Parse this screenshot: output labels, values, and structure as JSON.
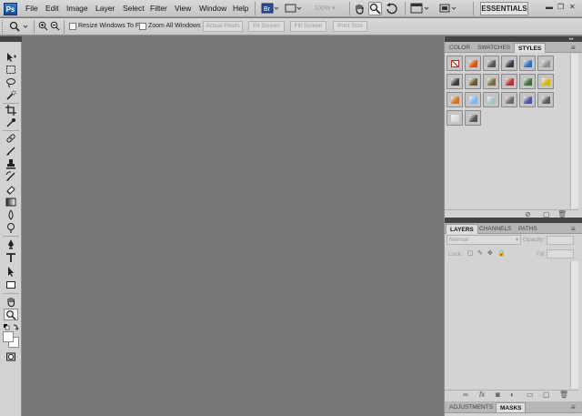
{
  "menubar": {
    "logo": "Ps",
    "items": [
      "File",
      "Edit",
      "Image",
      "Layer",
      "Select",
      "Filter",
      "View",
      "Window",
      "Help"
    ],
    "zoom_value": "100%",
    "workspace": "ESSENTIALS"
  },
  "options": {
    "resize_label": "Resize Windows To Fit",
    "zoom_all_label": "Zoom All Windows",
    "buttons": [
      "Actual Pixels",
      "Fit Screen",
      "Fill Screen",
      "Print Size"
    ]
  },
  "top_panel": {
    "tabs": [
      "COLOR",
      "SWATCHES",
      "STYLES"
    ],
    "active_tab": "STYLES",
    "style_colors": [
      "#c8c8c8",
      "#d0561a",
      "#555555",
      "#333a44",
      "#2f6fb3",
      "#8e8e8e",
      "#3c3c3c",
      "#6a5a32",
      "#7a6a3a",
      "#b0303a",
      "#3f6a3a",
      "#d6b318",
      "#c8742a",
      "#7eb6e8",
      "#a8c0c8",
      "#6a6a6a",
      "#5050a0",
      "#5a5a5a",
      "#d8d8d8",
      "#555555"
    ]
  },
  "layers_panel": {
    "tabs": [
      "LAYERS",
      "CHANNELS",
      "PATHS"
    ],
    "active_tab": "LAYERS",
    "blend_mode": "Normal",
    "opacity_label": "Opacity:",
    "lock_label": "Lock:",
    "fill_label": "Fill:"
  },
  "bottom_panel": {
    "tabs": [
      "ADJUSTMENTS",
      "MASKS"
    ],
    "active_tab": "MASKS"
  }
}
